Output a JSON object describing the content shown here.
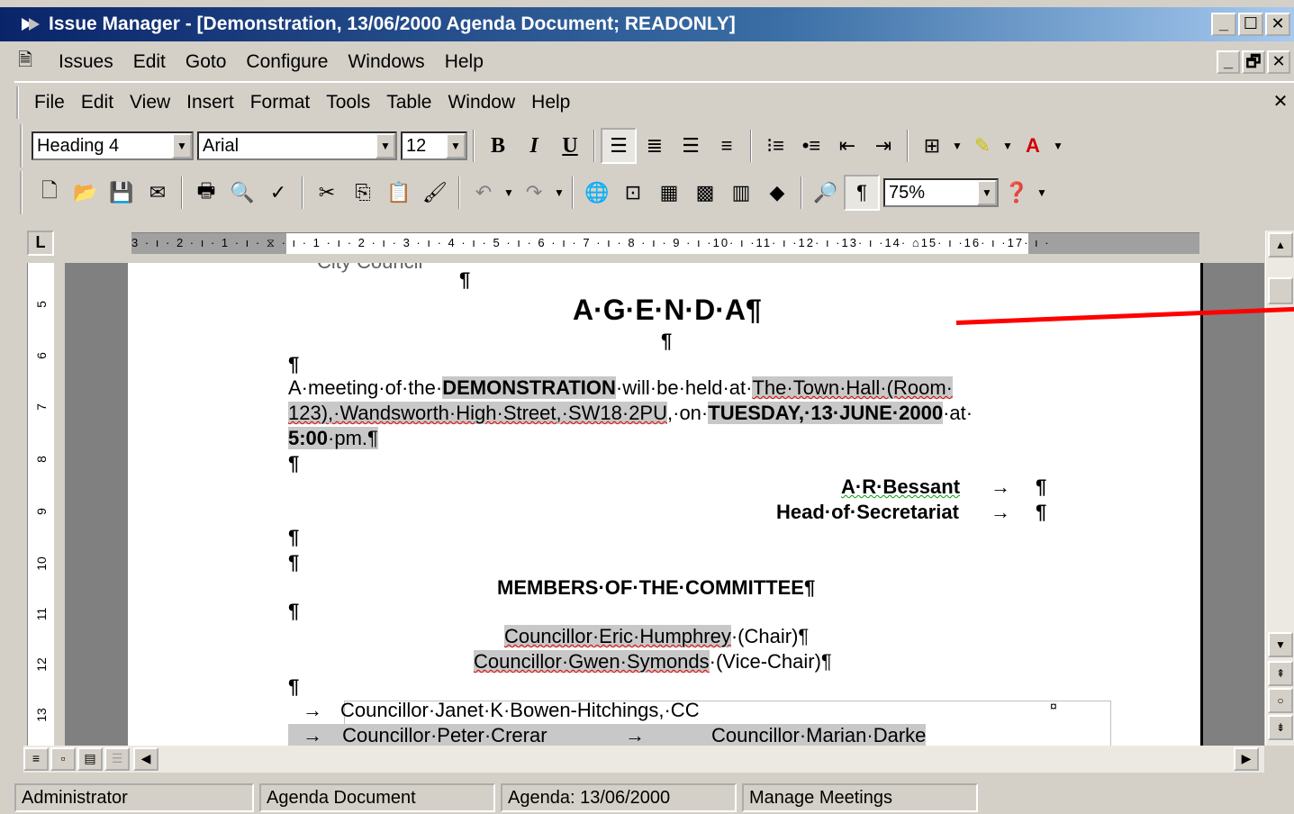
{
  "window": {
    "title": "Issue Manager - [Demonstration, 13/06/2000 Agenda Document; READONLY]",
    "min": "_",
    "max": "☐",
    "close": "✕",
    "restore": "🗗"
  },
  "app_menu": [
    "Issues",
    "Edit",
    "Goto",
    "Configure",
    "Windows",
    "Help"
  ],
  "word_menu": [
    "File",
    "Edit",
    "View",
    "Insert",
    "Format",
    "Tools",
    "Table",
    "Window",
    "Help"
  ],
  "format_toolbar": {
    "style": "Heading 4",
    "font": "Arial",
    "size": "12",
    "bold": "B",
    "italic": "I",
    "underline": "U"
  },
  "standard_toolbar": {
    "zoom": "75%",
    "pilcrow": "¶"
  },
  "ruler": {
    "corner": "L",
    "h_marks": "3 · ı · 2 · ı · 1 · ı · ⧖ · ı · 1 · ı · 2 · ı · 3 · ı · 4 · ı · 5 · ı · 6 · ı · 7 · ı · 8 · ı · 9 · ı ·10· ı ·11· ı ·12· ı ·13· ı ·14· ⌂15· ı ·16· ı ·17· ı ·",
    "v_marks": [
      "5",
      "6",
      "7",
      "8",
      "9",
      "10",
      "11",
      "12",
      "13"
    ]
  },
  "document": {
    "council": "City Council",
    "heading": "A·G·E·N·D·A¶",
    "para_mark": "¶",
    "line1_a": "A·meeting·of·the·",
    "line1_b": "DEMONSTRATION",
    "line1_c": "·will·be·held·at·",
    "line1_d": "The·Town·Hall·(Room·",
    "line2_a": "123),·Wandsworth·High·Street,·SW18·2PU",
    "line2_b": ",·on·",
    "line2_c": "TUESDAY,·13·JUNE·2000",
    "line2_d": "·at·",
    "line3_a": "5:00",
    "line3_b": "·pm.¶",
    "signer_name": "A·R·Bessant",
    "signer_title": "Head·of·Secretariat",
    "arrow": "→",
    "members_heading": "MEMBERS·OF·THE·COMMITTEE¶",
    "chair_name": "Councillor·Eric·Humphrey",
    "chair_role": "·(Chair)¶",
    "vice_name": "Councillor·Gwen·Symonds",
    "vice_role": "·(Vice-Chair)¶",
    "member1": "Councillor·Janet·K·Bowen-Hitchings,·CC",
    "member2": "Councillor·Peter·Crerar",
    "member3": "Councillor·Marian·Darke",
    "cell_end": "¤"
  },
  "status_bar": [
    "Administrator",
    "Agenda Document",
    "Agenda: 13/06/2000",
    "Manage Meetings"
  ]
}
